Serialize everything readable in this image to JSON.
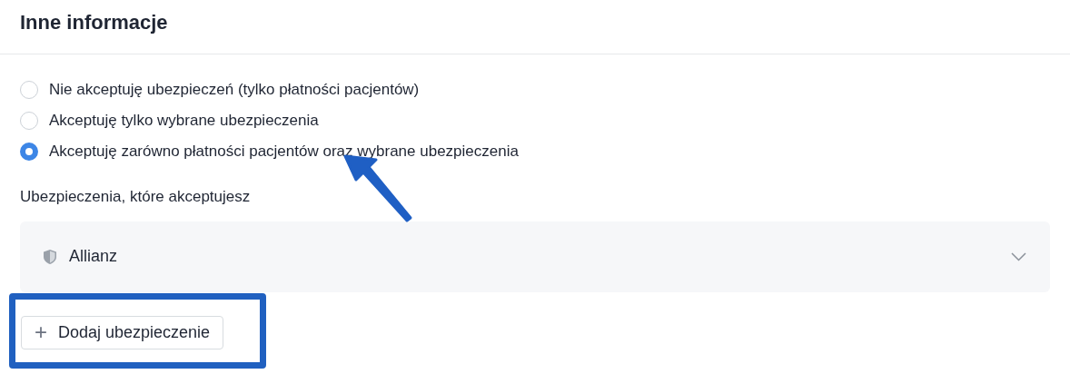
{
  "title": "Inne informacje",
  "options": [
    {
      "label": "Nie akceptuję ubezpieczeń (tylko płatności pacjentów)",
      "selected": false
    },
    {
      "label": "Akceptuję tylko wybrane ubezpieczenia",
      "selected": false
    },
    {
      "label": "Akceptuję zarówno płatności pacjentów oraz wybrane ubezpieczenia",
      "selected": true
    }
  ],
  "insurances_label": "Ubezpieczenia, które akceptujesz",
  "insurances": [
    {
      "name": "Allianz",
      "expanded": false
    }
  ],
  "add_button": {
    "label": "Dodaj ubezpieczenie",
    "icon": "+"
  }
}
